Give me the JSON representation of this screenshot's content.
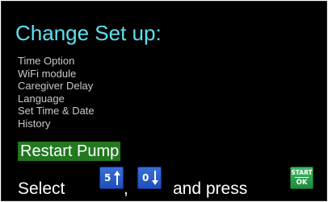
{
  "screen": {
    "title": "Change Set up:",
    "menu_items": [
      "Time Option",
      "WiFi module",
      "Caregiver Delay",
      "Language",
      "Set Time & Date",
      "History"
    ],
    "selected_item": "Restart Pump"
  },
  "footer": {
    "select_label": "Select",
    "comma": ",",
    "and_press_label": "and press"
  },
  "keys": {
    "up_key": {
      "digit": "5",
      "icon": "arrow-up-icon"
    },
    "down_key": {
      "digit": "0",
      "icon": "arrow-down-icon"
    },
    "start_ok_key": {
      "line1": "START",
      "line2": "OK"
    }
  },
  "colors": {
    "background": "#000000",
    "title": "#5ee0f0",
    "menu_text": "#c8c8c8",
    "selection_highlight": "#22781f",
    "key_blue": "#2c5fc8",
    "key_green": "#2aa150"
  }
}
